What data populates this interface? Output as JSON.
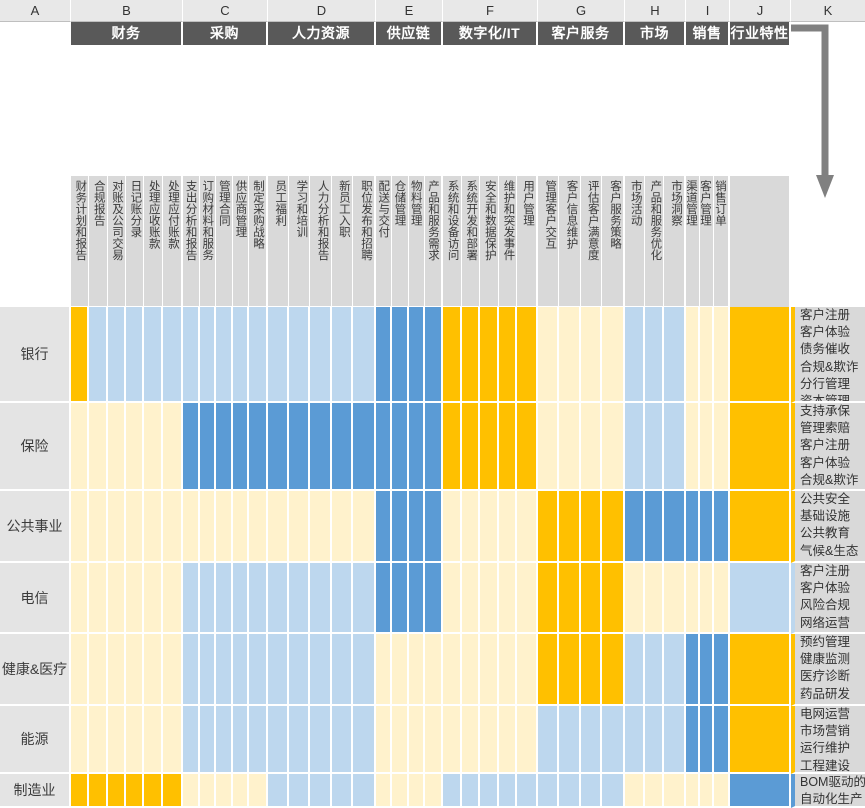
{
  "column_letters": [
    "A",
    "B",
    "C",
    "D",
    "E",
    "F",
    "G",
    "H",
    "I",
    "J",
    "K"
  ],
  "colors": {
    "high": "#FFC000",
    "dark_blue": "#5B9BD5",
    "light_blue": "#BDD7EE",
    "cream": "#FFF2CC",
    "group_header_bg": "#595959",
    "sub_header_bg": "#D9D9D9",
    "row_label_bg": "#E4E4E4",
    "colbar_bg": "#E8E8E8",
    "arrow": "#808080"
  },
  "groups": [
    {
      "col": "B",
      "label": "财务",
      "subs": [
        "财务计划和报告",
        "合规报告",
        "对账及公司交易",
        "日记账分录",
        "处理应收账款",
        "处理应付账款"
      ]
    },
    {
      "col": "C",
      "label": "采购",
      "subs": [
        "支出分析和报告",
        "订购材料和服务",
        "管理合同",
        "供应商管理",
        "制定采购战略"
      ]
    },
    {
      "col": "D",
      "label": "人力资源",
      "subs": [
        "员工福利",
        "学习和培训",
        "人力分析和报告",
        "新员工入职",
        "职位发布和招聘"
      ]
    },
    {
      "col": "E",
      "label": "供应链",
      "subs": [
        "配送与交付",
        "仓储管理",
        "物料管理",
        "产品和服务需求"
      ]
    },
    {
      "col": "F",
      "label": "数字化/IT",
      "subs": [
        "系统和设备访问",
        "系统开发和部署",
        "安全和数据保护",
        "维护和突发事件",
        "用户管理"
      ]
    },
    {
      "col": "G",
      "label": "客户服务",
      "subs": [
        "管理客户交互",
        "客户信息维护",
        "评估客户满意度",
        "客户服务策略"
      ]
    },
    {
      "col": "H",
      "label": "市场",
      "subs": [
        "市场活动",
        "产品和服务优化",
        "市场洞察"
      ]
    },
    {
      "col": "I",
      "label": "销售",
      "subs": [
        "渠道管理",
        "客户管理",
        "销售订单"
      ]
    },
    {
      "col": "J",
      "label": "行业特性",
      "subs": []
    }
  ],
  "rows": [
    {
      "label": "银行",
      "cells": {
        "B": [
          "high",
          "light_blue",
          "light_blue",
          "light_blue",
          "light_blue",
          "light_blue"
        ],
        "C": [
          "light_blue",
          "light_blue",
          "light_blue",
          "light_blue",
          "light_blue"
        ],
        "D": [
          "light_blue",
          "light_blue",
          "light_blue",
          "light_blue",
          "light_blue"
        ],
        "E": [
          "dark_blue",
          "dark_blue",
          "dark_blue",
          "dark_blue"
        ],
        "F": [
          "high",
          "high",
          "high",
          "high",
          "high"
        ],
        "G": [
          "cream",
          "cream",
          "cream",
          "cream"
        ],
        "H": [
          "light_blue",
          "light_blue",
          "light_blue"
        ],
        "I": [
          "cream",
          "cream",
          "cream"
        ],
        "J": [
          "high"
        ]
      },
      "industry": "客户注册\n客户体验\n债务催收\n合规&欺诈\n分行管理\n资本管理",
      "industry_color": "high"
    },
    {
      "label": "保险",
      "cells": {
        "B": [
          "cream",
          "cream",
          "cream",
          "cream",
          "cream",
          "cream"
        ],
        "C": [
          "dark_blue",
          "dark_blue",
          "dark_blue",
          "dark_blue",
          "dark_blue"
        ],
        "D": [
          "dark_blue",
          "dark_blue",
          "dark_blue",
          "dark_blue",
          "dark_blue"
        ],
        "E": [
          "dark_blue",
          "dark_blue",
          "dark_blue",
          "dark_blue"
        ],
        "F": [
          "high",
          "high",
          "high",
          "high",
          "high"
        ],
        "G": [
          "cream",
          "cream",
          "cream",
          "cream"
        ],
        "H": [
          "light_blue",
          "light_blue",
          "light_blue"
        ],
        "I": [
          "cream",
          "cream",
          "cream"
        ],
        "J": [
          "high"
        ]
      },
      "industry": "支持承保\n管理索赔\n客户注册\n客户体验\n合规&欺诈",
      "industry_color": "high"
    },
    {
      "label": "公共事业",
      "cells": {
        "B": [
          "cream",
          "cream",
          "cream",
          "cream",
          "cream",
          "cream"
        ],
        "C": [
          "cream",
          "cream",
          "cream",
          "cream",
          "cream"
        ],
        "D": [
          "cream",
          "cream",
          "cream",
          "cream",
          "cream"
        ],
        "E": [
          "dark_blue",
          "dark_blue",
          "dark_blue",
          "dark_blue"
        ],
        "F": [
          "cream",
          "cream",
          "cream",
          "cream",
          "cream"
        ],
        "G": [
          "high",
          "high",
          "high",
          "high"
        ],
        "H": [
          "dark_blue",
          "dark_blue",
          "dark_blue"
        ],
        "I": [
          "dark_blue",
          "dark_blue",
          "dark_blue"
        ],
        "J": [
          "high"
        ]
      },
      "industry": "公共安全\n基础设施\n公共教育\n气候&生态",
      "industry_color": "high"
    },
    {
      "label": "电信",
      "cells": {
        "B": [
          "cream",
          "cream",
          "cream",
          "cream",
          "cream",
          "cream"
        ],
        "C": [
          "light_blue",
          "light_blue",
          "light_blue",
          "light_blue",
          "light_blue"
        ],
        "D": [
          "light_blue",
          "light_blue",
          "light_blue",
          "light_blue",
          "light_blue"
        ],
        "E": [
          "dark_blue",
          "dark_blue",
          "dark_blue",
          "dark_blue"
        ],
        "F": [
          "cream",
          "cream",
          "cream",
          "cream",
          "cream"
        ],
        "G": [
          "high",
          "high",
          "high",
          "high"
        ],
        "H": [
          "cream",
          "cream",
          "cream"
        ],
        "I": [
          "cream",
          "cream",
          "cream"
        ],
        "J": [
          "light_blue"
        ]
      },
      "industry": "客户注册\n客户体验\n风险合规\n网络运营",
      "industry_color": "light_blue"
    },
    {
      "label": "健康&医疗",
      "cells": {
        "B": [
          "cream",
          "cream",
          "cream",
          "cream",
          "cream",
          "cream"
        ],
        "C": [
          "light_blue",
          "light_blue",
          "light_blue",
          "light_blue",
          "light_blue"
        ],
        "D": [
          "light_blue",
          "light_blue",
          "light_blue",
          "light_blue",
          "light_blue"
        ],
        "E": [
          "cream",
          "cream",
          "cream",
          "cream"
        ],
        "F": [
          "cream",
          "cream",
          "cream",
          "cream",
          "cream"
        ],
        "G": [
          "high",
          "high",
          "high",
          "high"
        ],
        "H": [
          "light_blue",
          "light_blue",
          "light_blue"
        ],
        "I": [
          "dark_blue",
          "dark_blue",
          "dark_blue"
        ],
        "J": [
          "high"
        ]
      },
      "industry": "预约管理\n健康监测\n医疗诊断\n药品研发",
      "industry_color": "high"
    },
    {
      "label": "能源",
      "cells": {
        "B": [
          "cream",
          "cream",
          "cream",
          "cream",
          "cream",
          "cream"
        ],
        "C": [
          "light_blue",
          "light_blue",
          "light_blue",
          "light_blue",
          "light_blue"
        ],
        "D": [
          "light_blue",
          "light_blue",
          "light_blue",
          "light_blue",
          "light_blue"
        ],
        "E": [
          "cream",
          "cream",
          "cream",
          "cream"
        ],
        "F": [
          "cream",
          "cream",
          "cream",
          "cream",
          "cream"
        ],
        "G": [
          "light_blue",
          "light_blue",
          "light_blue",
          "light_blue"
        ],
        "H": [
          "light_blue",
          "light_blue",
          "light_blue"
        ],
        "I": [
          "dark_blue",
          "dark_blue",
          "dark_blue"
        ],
        "J": [
          "high"
        ]
      },
      "industry": "电网运营\n市场营销\n运行维护\n工程建设",
      "industry_color": "high"
    },
    {
      "label": "制造业",
      "cells": {
        "B": [
          "high",
          "high",
          "high",
          "high",
          "high",
          "high"
        ],
        "C": [
          "cream",
          "cream",
          "cream",
          "cream",
          "cream"
        ],
        "D": [
          "light_blue",
          "light_blue",
          "light_blue",
          "light_blue",
          "light_blue"
        ],
        "E": [
          "cream",
          "cream",
          "cream",
          "cream"
        ],
        "F": [
          "light_blue",
          "light_blue",
          "light_blue",
          "light_blue",
          "light_blue"
        ],
        "G": [
          "light_blue",
          "light_blue",
          "light_blue",
          "light_blue"
        ],
        "H": [
          "cream",
          "cream",
          "cream"
        ],
        "I": [
          "cream",
          "cream",
          "cream"
        ],
        "J": [
          "dark_blue"
        ]
      },
      "industry": "BOM驱动的\n自动化生产",
      "industry_color": "dark_blue"
    }
  ],
  "annotation": {
    "arrow_name": "down-arrow-to-industry-column"
  }
}
